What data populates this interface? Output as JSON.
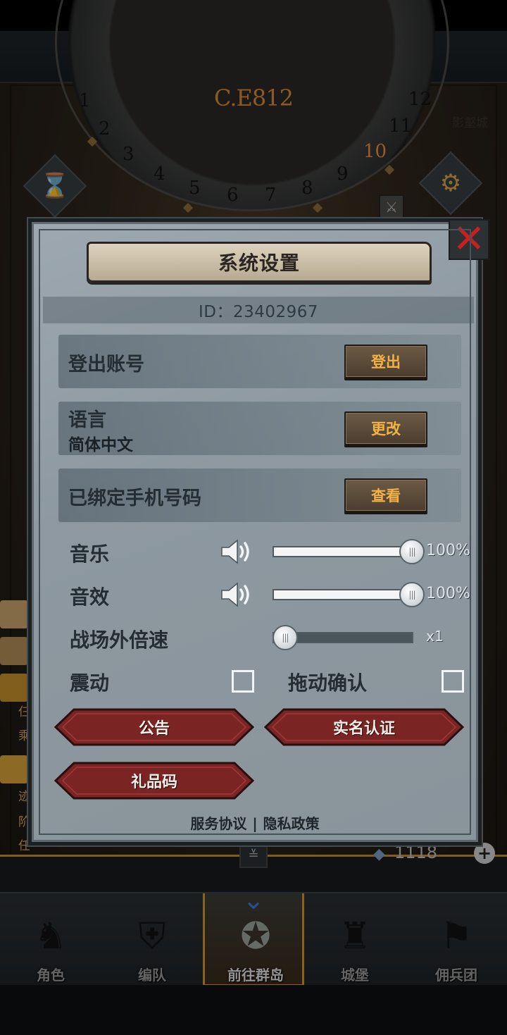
{
  "background": {
    "era_label": "C.E812",
    "dial_numbers": [
      "1",
      "2",
      "3",
      "4",
      "5",
      "6",
      "7",
      "8",
      "9",
      "10",
      "11",
      "12"
    ],
    "highlighted_number": "10",
    "city_label": "影壑城",
    "gem_count": "1118",
    "plus": "+",
    "side_texts": [
      "仨",
      "乘",
      "迹",
      "阶",
      "任"
    ]
  },
  "nav": {
    "items": [
      {
        "label": "角色",
        "icon": "knight-icon"
      },
      {
        "label": "编队",
        "icon": "helmet-squad-icon"
      },
      {
        "label": "前往群岛",
        "icon": "globe-compass-icon"
      },
      {
        "label": "城堡",
        "icon": "castle-icon"
      },
      {
        "label": "佣兵团",
        "icon": "mercenary-banner-icon"
      }
    ],
    "active_index": 2
  },
  "dialog": {
    "title": "系统设置",
    "close": "✕",
    "id_text": "ID：23402967",
    "rows": {
      "logout": {
        "label": "登出账号",
        "button": "登出"
      },
      "language": {
        "label": "语言",
        "value": "简体中文",
        "button": "更改"
      },
      "phone": {
        "label": "已绑定手机号码",
        "button": "查看"
      }
    },
    "music": {
      "label": "音乐",
      "value": "100%",
      "level": 1.0
    },
    "sfx": {
      "label": "音效",
      "value": "100%",
      "level": 1.0
    },
    "speed": {
      "label": "战场外倍速",
      "value": "x1",
      "level": 0.0
    },
    "vibrate": {
      "label": "震动",
      "checked": false
    },
    "drag_confirm": {
      "label": "拖动确认",
      "checked": false
    },
    "buttons": {
      "notice": "公告",
      "realname": "实名认证",
      "giftcode": "礼品码"
    },
    "links": {
      "service": "服务协议",
      "separator": "|",
      "privacy": "隐私政策"
    },
    "colors": {
      "accent_orange": "#f2b245",
      "close_red": "#c62020",
      "red_button": "#7a2424"
    }
  }
}
